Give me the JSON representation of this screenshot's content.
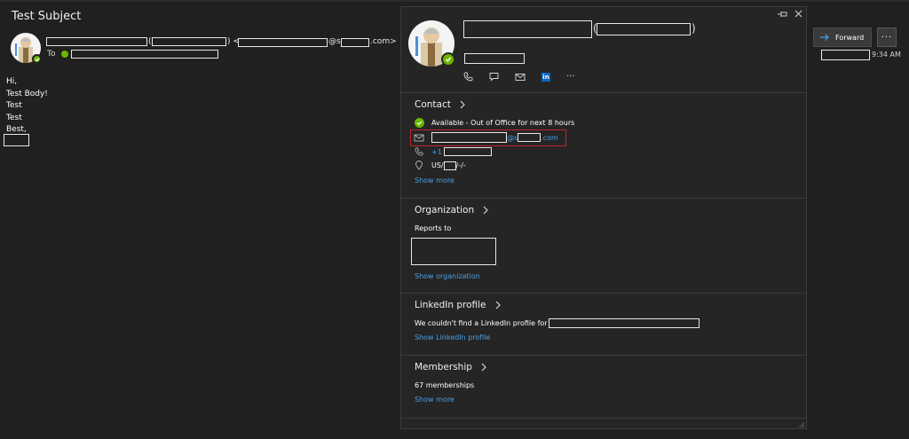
{
  "email": {
    "subject": "Test Subject",
    "sender_paren_open": "(",
    "sender_paren_close": ") <",
    "sender_email_at": "@s",
    "sender_email_suffix": ".com>",
    "to_label": "To",
    "body_lines": [
      "Hi,",
      "Test Body!",
      "Test",
      "Test",
      "Best,"
    ],
    "time": "9:34 AM",
    "forward_label": "Forward",
    "more_label": "···"
  },
  "card": {
    "name_paren_open": "(",
    "name_paren_close": ")",
    "contact": {
      "title": "Contact",
      "status": "Available - Out of Office for next 8 hours",
      "email_at": "@s",
      "email_suffix": ".com",
      "phone_prefix": "+1",
      "location_prefix": "US/",
      "location_suffix": "/-/-",
      "show_more": "Show more"
    },
    "organization": {
      "title": "Organization",
      "reports_to": "Reports to",
      "show_org": "Show organization"
    },
    "linkedin": {
      "title": "LinkedIn profile",
      "text": "We couldn't find a LinkedIn profile for",
      "show_link": "Show LinkedIn profile"
    },
    "membership": {
      "title": "Membership",
      "count": "67 memberships",
      "show_more": "Show more"
    },
    "actions": [
      "phone-icon",
      "chat-icon",
      "mail-icon",
      "linkedin-icon",
      "more-icon"
    ],
    "linkedin_badge": "in",
    "more_dots": "···"
  },
  "colors": {
    "background": "#202020",
    "card_background": "#252525",
    "link": "#4aa0e6",
    "presence": "#6bb700",
    "highlight": "#c0262d"
  }
}
